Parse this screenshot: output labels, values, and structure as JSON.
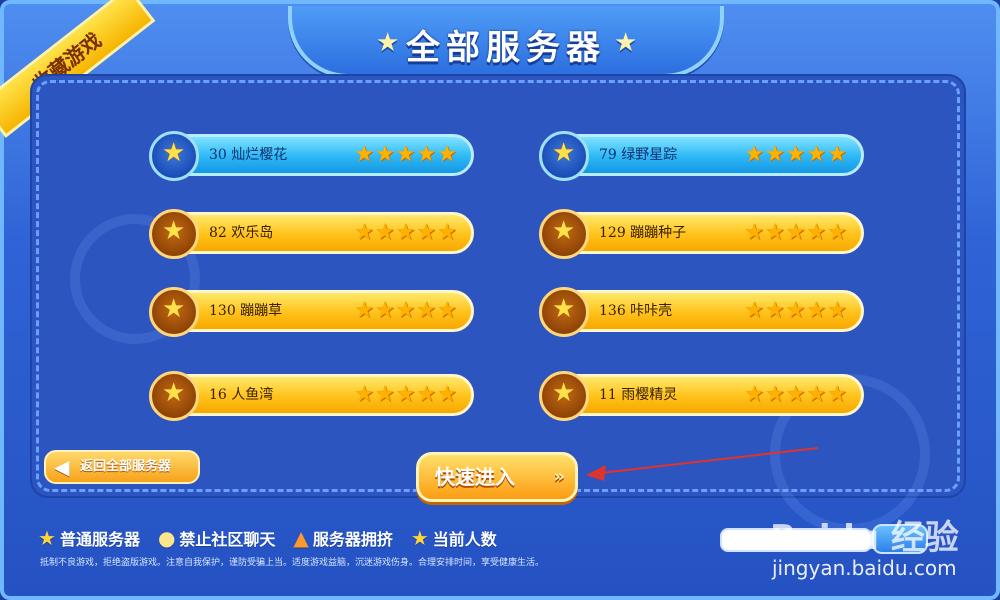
{
  "header": {
    "title": "全部服务器",
    "ribbon": "收藏游戏"
  },
  "servers": [
    {
      "label": "30  灿烂樱花",
      "stars": 5,
      "active": true
    },
    {
      "label": "79  绿野星踪",
      "stars": 5,
      "active": true
    },
    {
      "label": "82  欢乐岛",
      "stars": 5,
      "active": false
    },
    {
      "label": "129  蹦蹦种子",
      "stars": 5,
      "active": false
    },
    {
      "label": "130  蹦蹦草",
      "stars": 5,
      "active": false
    },
    {
      "label": "136  咔咔壳",
      "stars": 5,
      "active": false
    },
    {
      "label": "16  人鱼湾",
      "stars": 5,
      "active": false
    },
    {
      "label": "11  雨樱精灵",
      "stars": 5,
      "active": false
    }
  ],
  "buttons": {
    "back": "返回全部服务器",
    "enter": "快速进入"
  },
  "legend": [
    {
      "icon": "star-icon",
      "label": "普通服务器"
    },
    {
      "icon": "chick-icon",
      "label": "禁止社区聊天"
    },
    {
      "icon": "hammer-icon",
      "label": "服务器拥挤"
    },
    {
      "icon": "person-star-icon",
      "label": "当前人数"
    }
  ],
  "footer": {
    "notice": "抵制不良游戏，拒绝盗版游戏。注意自我保护，谨防受骗上当。适度游戏益脑，沉迷游戏伤身。合理安排时间，享受健康生活。"
  },
  "search": {
    "value": ""
  },
  "watermark": {
    "brand": "Baidu 经验",
    "url": "jingyan.baidu.com"
  },
  "colors": {
    "accent_blue": "#2db8f6",
    "accent_gold": "#ffc21a",
    "arrow_red": "#e0332b"
  }
}
